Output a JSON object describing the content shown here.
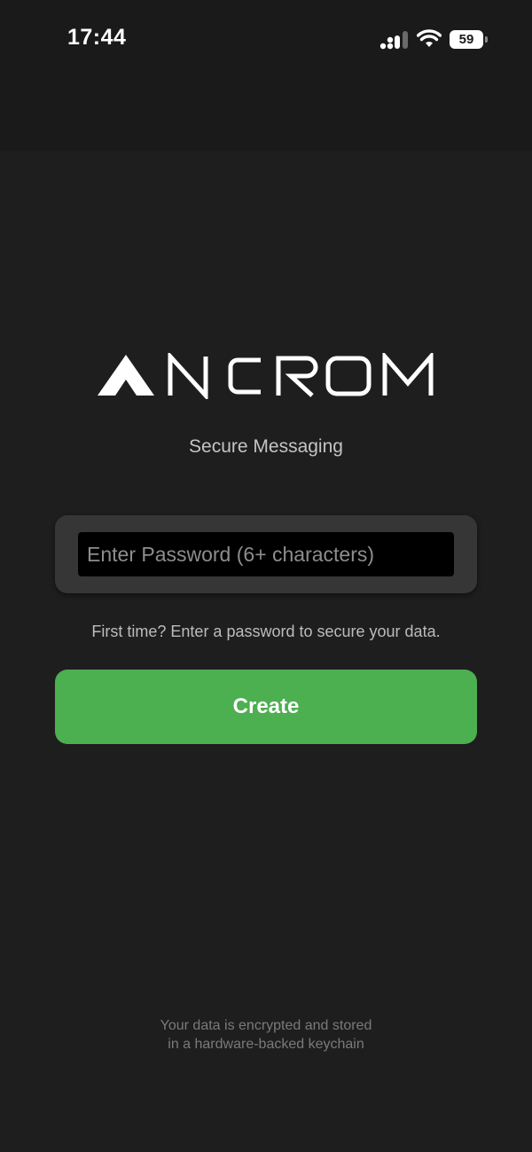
{
  "status_bar": {
    "time": "17:44",
    "battery": "59",
    "icons": [
      "signal-icon",
      "wifi-icon",
      "battery-icon"
    ]
  },
  "brand": {
    "logo_text": "ANCROM",
    "subtitle": "Secure Messaging"
  },
  "password": {
    "value": "",
    "placeholder": "Enter Password (6+ characters)"
  },
  "hint": "First time? Enter a password to secure your data.",
  "create_label": "Create",
  "footer": {
    "line1": "Your data is encrypted and stored",
    "line2": "in a hardware-backed keychain"
  },
  "colors": {
    "background": "#1e1e1e",
    "accent": "#4caf50",
    "input_card": "#363636"
  }
}
